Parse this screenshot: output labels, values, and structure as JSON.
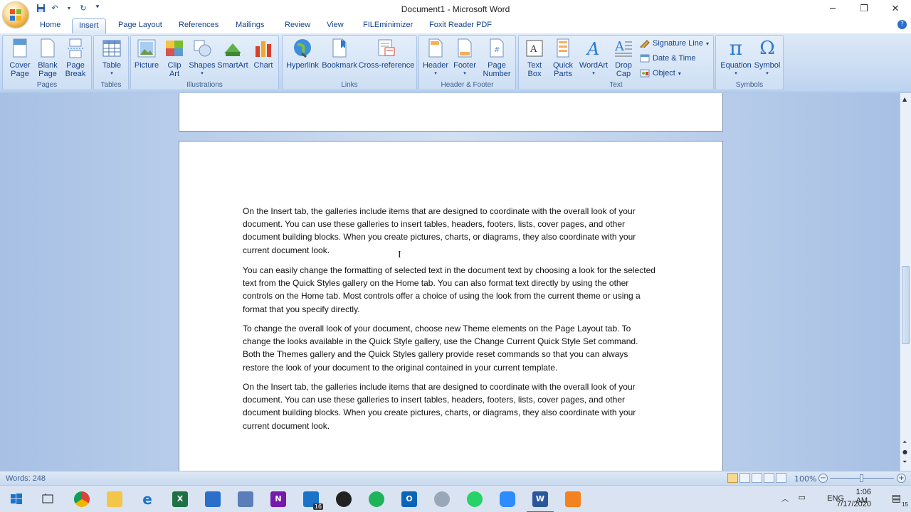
{
  "window": {
    "title": "Document1 - Microsoft Word",
    "minimize": "─",
    "restore": "❐",
    "close": "✕"
  },
  "qat": {
    "save_icon": "save-icon",
    "undo_icon": "undo-icon",
    "redo_icon": "redo-icon",
    "customize_icon": "chevron-down-icon"
  },
  "tabs": [
    "Home",
    "Insert",
    "Page Layout",
    "References",
    "Mailings",
    "Review",
    "View",
    "FILEminimizer",
    "Foxit Reader PDF"
  ],
  "active_tab": "Insert",
  "ribbon": {
    "groups": {
      "pages": "Pages",
      "tables": "Tables",
      "illustrations": "Illustrations",
      "links": "Links",
      "header_footer": "Header & Footer",
      "text": "Text",
      "symbols": "Symbols"
    },
    "buttons": {
      "cover_page": [
        "Cover",
        "Page"
      ],
      "blank_page": [
        "Blank",
        "Page"
      ],
      "page_break": [
        "Page",
        "Break"
      ],
      "table": "Table",
      "picture": "Picture",
      "clip_art": [
        "Clip",
        "Art"
      ],
      "shapes": "Shapes",
      "smartart": "SmartArt",
      "chart": "Chart",
      "hyperlink": "Hyperlink",
      "bookmark": "Bookmark",
      "cross_reference": "Cross-reference",
      "header": "Header",
      "footer": "Footer",
      "page_number": [
        "Page",
        "Number"
      ],
      "text_box": [
        "Text",
        "Box"
      ],
      "quick_parts": [
        "Quick",
        "Parts"
      ],
      "wordart": "WordArt",
      "drop_cap": [
        "Drop",
        "Cap"
      ],
      "signature_line": "Signature Line",
      "date_time": "Date & Time",
      "object": "Object",
      "equation": "Equation",
      "symbol": "Symbol"
    }
  },
  "document": {
    "paragraphs": [
      "On the Insert tab, the galleries include items that are designed to coordinate with the overall look of your document. You can use these galleries to insert tables, headers, footers, lists, cover pages, and other document building blocks. When you create pictures, charts, or diagrams, they also coordinate with your current document look.",
      "You can easily change the formatting of selected text in the document text by choosing a look for the selected text from the Quick Styles gallery on the Home tab. You can also format text directly by using the other controls on the Home tab. Most controls offer a choice of using the look from the current theme or using a format that you specify directly.",
      "To change the overall look of your document, choose new Theme elements on the Page Layout tab. To change the looks available in the Quick Style gallery, use the Change Current Quick Style Set command. Both the Themes gallery and the Quick Styles gallery provide reset commands so that you can always restore the look of your document to the original contained in your current template.",
      "On the Insert tab, the galleries include items that are designed to coordinate with the overall look of your document. You can use these galleries to insert tables, headers, footers, lists, cover pages, and other document building blocks. When you create pictures, charts, or diagrams, they also coordinate with your current document look."
    ]
  },
  "status": {
    "words": "Words: 248",
    "zoom": "100%",
    "zoom_level_percent": 100
  },
  "taskbar": {
    "apps": [
      "start-icon",
      "task-view-icon",
      "chrome-icon",
      "file-explorer-icon",
      "edge-icon",
      "excel-icon",
      "store-icon",
      "calculator-icon",
      "onenote-icon",
      "mail-icon",
      "snipping-icon",
      "whatsapp-desktop-icon",
      "outlook-icon",
      "paint-icon",
      "whatsapp-icon",
      "zoom-icon",
      "word-icon",
      "foxit-icon"
    ],
    "mail_badge": "16",
    "lang": "ENG",
    "time": "1:06 AM",
    "date": "7/17/2020",
    "notification_count": "15"
  },
  "colors": {
    "ribbon_bg": "#c7daf2",
    "accent": "#15428b",
    "doc_bg": "#a7c0e4"
  }
}
